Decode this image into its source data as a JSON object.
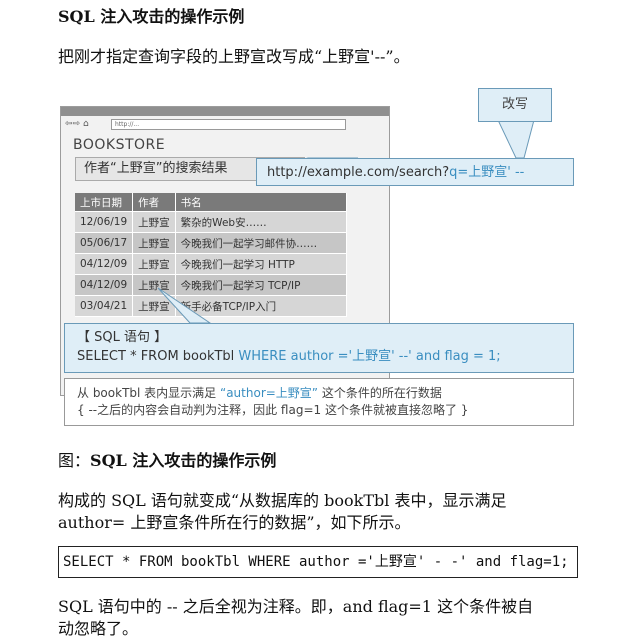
{
  "section_title": "SQL 注入攻击的操作示例",
  "intro": "把刚才指定查询字段的上野宣改写成“上野宣'--”。",
  "figure": {
    "nav_glyphs": "⇦⇨ ⌂",
    "address_placeholder": "http://...",
    "store_name": "BOOKSTORE",
    "search_heading": "作者“上野宣”的搜索结果",
    "columns": [
      "上市日期",
      "作者",
      "书名"
    ],
    "rows": [
      [
        "12/06/19",
        "上野宣",
        "繁杂的Web安……"
      ],
      [
        "05/06/17",
        "上野宣",
        "今晚我们一起学习邮件协……"
      ],
      [
        "04/12/09",
        "上野宣",
        "今晚我们一起学习 HTTP"
      ],
      [
        "04/12/09",
        "上野宣",
        "今晚我们一起学习 TCP/IP"
      ],
      [
        "03/04/21",
        "上野宣",
        "新手必备TCP/IP入门"
      ]
    ],
    "url_prefix": "http://example.com/search?",
    "url_param": "q=上野宣' --",
    "edit_label": "改写",
    "sql_label": "【 SQL 语句 】",
    "sql_prefix": "SELECT * FROM bookTbl",
    "sql_suffix": " WHERE author ='上野宣' --' and flag = 1;",
    "note_line1_pre": "从 bookTbl 表内显示满足 ",
    "note_line1_hl": "“author=上野宣”",
    "note_line1_post": " 这个条件的所在行数据",
    "note_line2": "{ --之后的内容会自动判为注释，因此 flag=1 这个条件就被直接忽略了 }"
  },
  "caption_prefix": "图：",
  "caption": "SQL 注入攻击的操作示例",
  "para1_line1": "构成的 SQL 语句就变成“从数据库的 bookTbl 表中，显示满足",
  "para1_line2": "author= 上野宣条件所在行的数据”，如下所示。",
  "code": "SELECT * FROM bookTbl WHERE author ='上野宣' - -' and flag=1;",
  "para2_line1": "SQL 语句中的 -- 之后全视为注释。即，and flag=1 这个条件被自",
  "para2_line2": "动忽略了。"
}
